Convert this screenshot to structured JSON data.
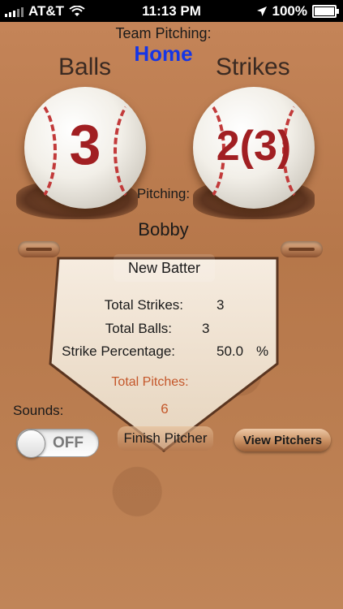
{
  "status_bar": {
    "carrier": "AT&T",
    "time": "11:13 PM",
    "battery": "100%"
  },
  "header": {
    "team_pitching_label": "Team Pitching:",
    "team_name": "Home",
    "team_color": "#1535e6"
  },
  "counts": {
    "balls_title": "Balls",
    "strikes_title": "Strikes",
    "balls_value": "3",
    "strikes_value": "2(3)",
    "count_color": "#a11f22"
  },
  "pitcher": {
    "label": "Pitching:",
    "name": "Bobby"
  },
  "buttons": {
    "new_batter": "New Batter",
    "finish_pitcher": "Finish Pitcher",
    "view_pitchers": "View Pitchers"
  },
  "stats": {
    "total_strikes_label": "Total Strikes:",
    "total_strikes_value": "3",
    "total_balls_label": "Total Balls:",
    "total_balls_value": "3",
    "strike_pct_label": "Strike Percentage:",
    "strike_pct_value": "50.0",
    "strike_pct_unit": "%",
    "total_pitches_label": "Total Pitches:",
    "total_pitches_value": "6",
    "total_pitches_color": "#c4572a"
  },
  "sounds": {
    "label": "Sounds:",
    "toggle_state": "OFF"
  }
}
